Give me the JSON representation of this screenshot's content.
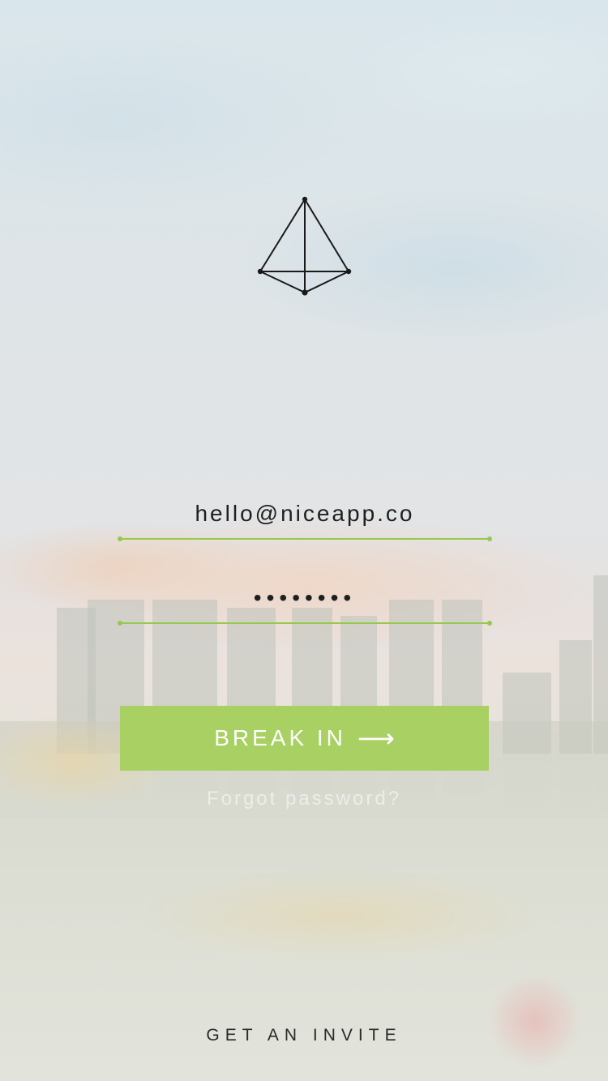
{
  "login": {
    "email_value": "hello@niceapp.co",
    "password_value": "••••••••",
    "submit_label": "BREAK IN",
    "submit_arrow": "⟶",
    "forgot_label": "Forgot password?",
    "invite_label": "GET AN INVITE"
  },
  "logo": {
    "icon": "pyramid-logo-icon"
  },
  "colors": {
    "accent": "#a8d062",
    "underline": "#95c94d",
    "text": "#1f1f1f"
  }
}
